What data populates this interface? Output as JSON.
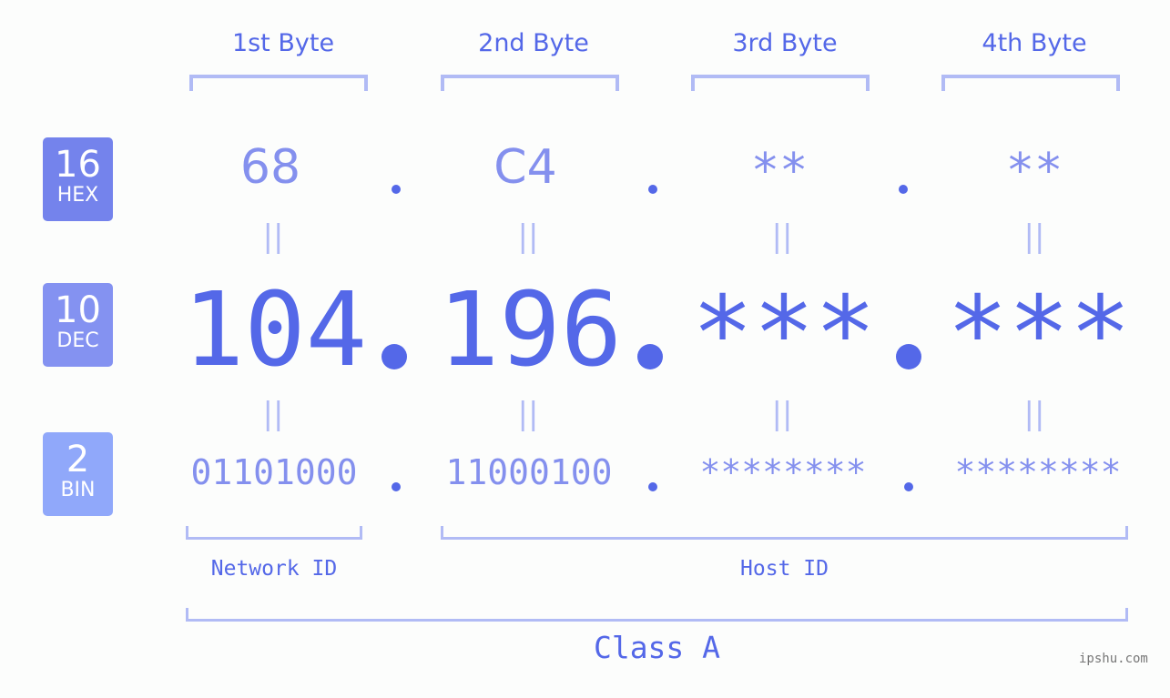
{
  "bytes": [
    {
      "title": "1st Byte",
      "hex": "68",
      "dec": "104",
      "bin": "01101000"
    },
    {
      "title": "2nd Byte",
      "hex": "C4",
      "dec": "196",
      "bin": "11000100"
    },
    {
      "title": "3rd Byte",
      "hex": "**",
      "dec": "***",
      "bin": "********"
    },
    {
      "title": "4th Byte",
      "hex": "**",
      "dec": "***",
      "bin": "********"
    }
  ],
  "bases": [
    {
      "num": "16",
      "label": "HEX",
      "color": "#7483ec"
    },
    {
      "num": "10",
      "label": "DEC",
      "color": "#8492f1"
    },
    {
      "num": "2",
      "label": "BIN",
      "color": "#90a8fa"
    }
  ],
  "equals_symbol": "||",
  "separator": ".",
  "network_label": "Network ID",
  "host_label": "Host ID",
  "class_label": "Class A",
  "watermark": "ipshu.com",
  "colors": {
    "accent": "#5468e8",
    "light": "#8490ee",
    "bracket": "#b1bbf5"
  }
}
